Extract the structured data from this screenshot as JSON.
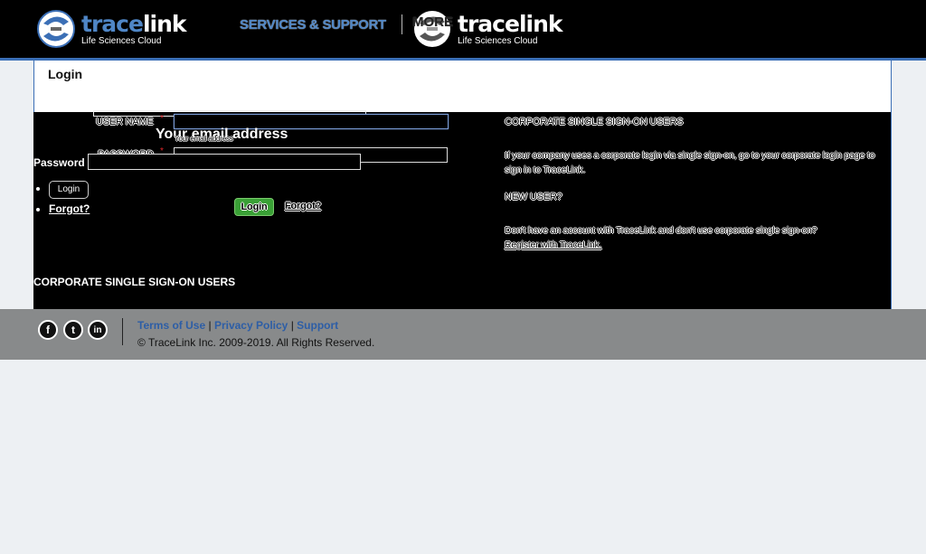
{
  "header": {
    "logo_left": {
      "word_a": "trace",
      "word_b": "link",
      "subtitle": "Life Sciences Cloud"
    },
    "services_link": "SERVICES & SUPPORT",
    "more_label": "MORE",
    "logo_right": {
      "word_a": "trace",
      "word_b": "link",
      "subtitle": "Life Sciences Cloud"
    }
  },
  "login": {
    "title": "Login",
    "username_label": "USER NAME",
    "required_mark": "*",
    "email_hint": "Your email address",
    "email_hint_small": "Your email address",
    "password_label": "PASSWORD",
    "password_plain_label": "Password",
    "list_items": {
      "login_mini": "Login",
      "forgot": "Forgot?"
    },
    "login_button": "Login",
    "forgot_link": "Forgot?",
    "sso_bottom": "CORPORATE SINGLE SIGN-ON USERS"
  },
  "right_column": {
    "sso_heading": "CORPORATE SINGLE SIGN-ON USERS",
    "sso_text": "If your company uses a corporate login via single sign-on, go to your corporate login page to sign in to TraceLink.",
    "new_user_heading": "NEW USER?",
    "new_user_text": "Don't have an account with TraceLink and don't use corporate single sign-on?",
    "register_link": "Register with TraceLink."
  },
  "footer": {
    "social": {
      "facebook": "f",
      "twitter": "t",
      "linkedin": "in"
    },
    "terms": "Terms of Use",
    "privacy": "Privacy Policy",
    "support": "Support",
    "separator": "|",
    "copyright": "© TraceLink Inc. 2009-2019. All Rights Reserved."
  },
  "colors": {
    "brand_blue": "#4f86c6",
    "header_bg": "#000000",
    "footer_bg": "#888a8b",
    "login_green": "#3aa036"
  }
}
